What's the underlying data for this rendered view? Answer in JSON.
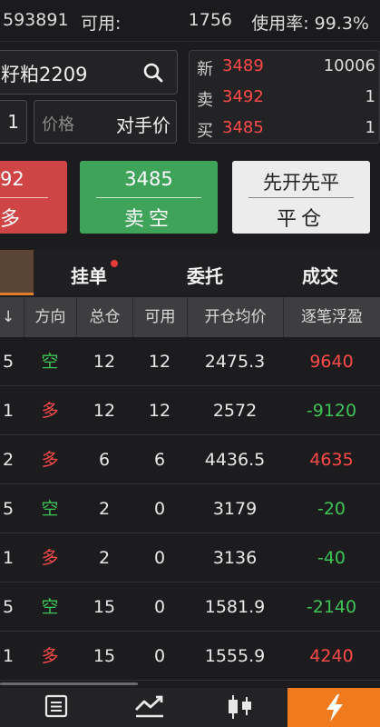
{
  "topbar": {
    "account": "593891",
    "available_label": "可用:",
    "available_value": "1756",
    "usage": "使用率: 99.3%"
  },
  "instrument": {
    "name": "籽粕2209"
  },
  "quote": {
    "rows": [
      {
        "label": "新",
        "price": "3489",
        "volume": "10006"
      },
      {
        "label": "卖",
        "price": "3492",
        "volume": "1"
      },
      {
        "label": "买",
        "price": "3485",
        "volume": "1"
      }
    ]
  },
  "order": {
    "qty": "1",
    "price_placeholder": "价格",
    "counterparty_label": "对手价"
  },
  "buttons": {
    "buy_price": "92",
    "buy_label": "多",
    "sell_price": "3485",
    "sell_label": "卖空",
    "close_top": "先开先平",
    "close_label": "平仓"
  },
  "tabs": {
    "pending": "挂单",
    "orders": "委托",
    "trades": "成交"
  },
  "table": {
    "headers": [
      "↓",
      "方向",
      "总仓",
      "可用",
      "开仓均价",
      "逐笔浮盈"
    ],
    "rows": [
      {
        "c0": "5",
        "dir": "空",
        "total": "12",
        "avail": "12",
        "avg": "2475.3",
        "pnl": "9640"
      },
      {
        "c0": "1",
        "dir": "多",
        "total": "12",
        "avail": "12",
        "avg": "2572",
        "pnl": "-9120"
      },
      {
        "c0": "2",
        "dir": "多",
        "total": "6",
        "avail": "6",
        "avg": "4436.5",
        "pnl": "4635"
      },
      {
        "c0": "5",
        "dir": "空",
        "total": "2",
        "avail": "0",
        "avg": "3179",
        "pnl": "-20"
      },
      {
        "c0": "1",
        "dir": "多",
        "total": "2",
        "avail": "0",
        "avg": "3136",
        "pnl": "-40"
      },
      {
        "c0": "5",
        "dir": "空",
        "total": "15",
        "avail": "0",
        "avg": "1581.9",
        "pnl": "-2140"
      },
      {
        "c0": "1",
        "dir": "多",
        "total": "15",
        "avail": "0",
        "avg": "1555.9",
        "pnl": "4240"
      }
    ]
  },
  "colors": {
    "accent": "#f07a1e",
    "up": "#ff4a4a",
    "down": "#3ec456"
  },
  "nav": {
    "icons": [
      "list-icon",
      "trend-chart-icon",
      "candlestick-icon",
      "lightning-icon"
    ]
  }
}
